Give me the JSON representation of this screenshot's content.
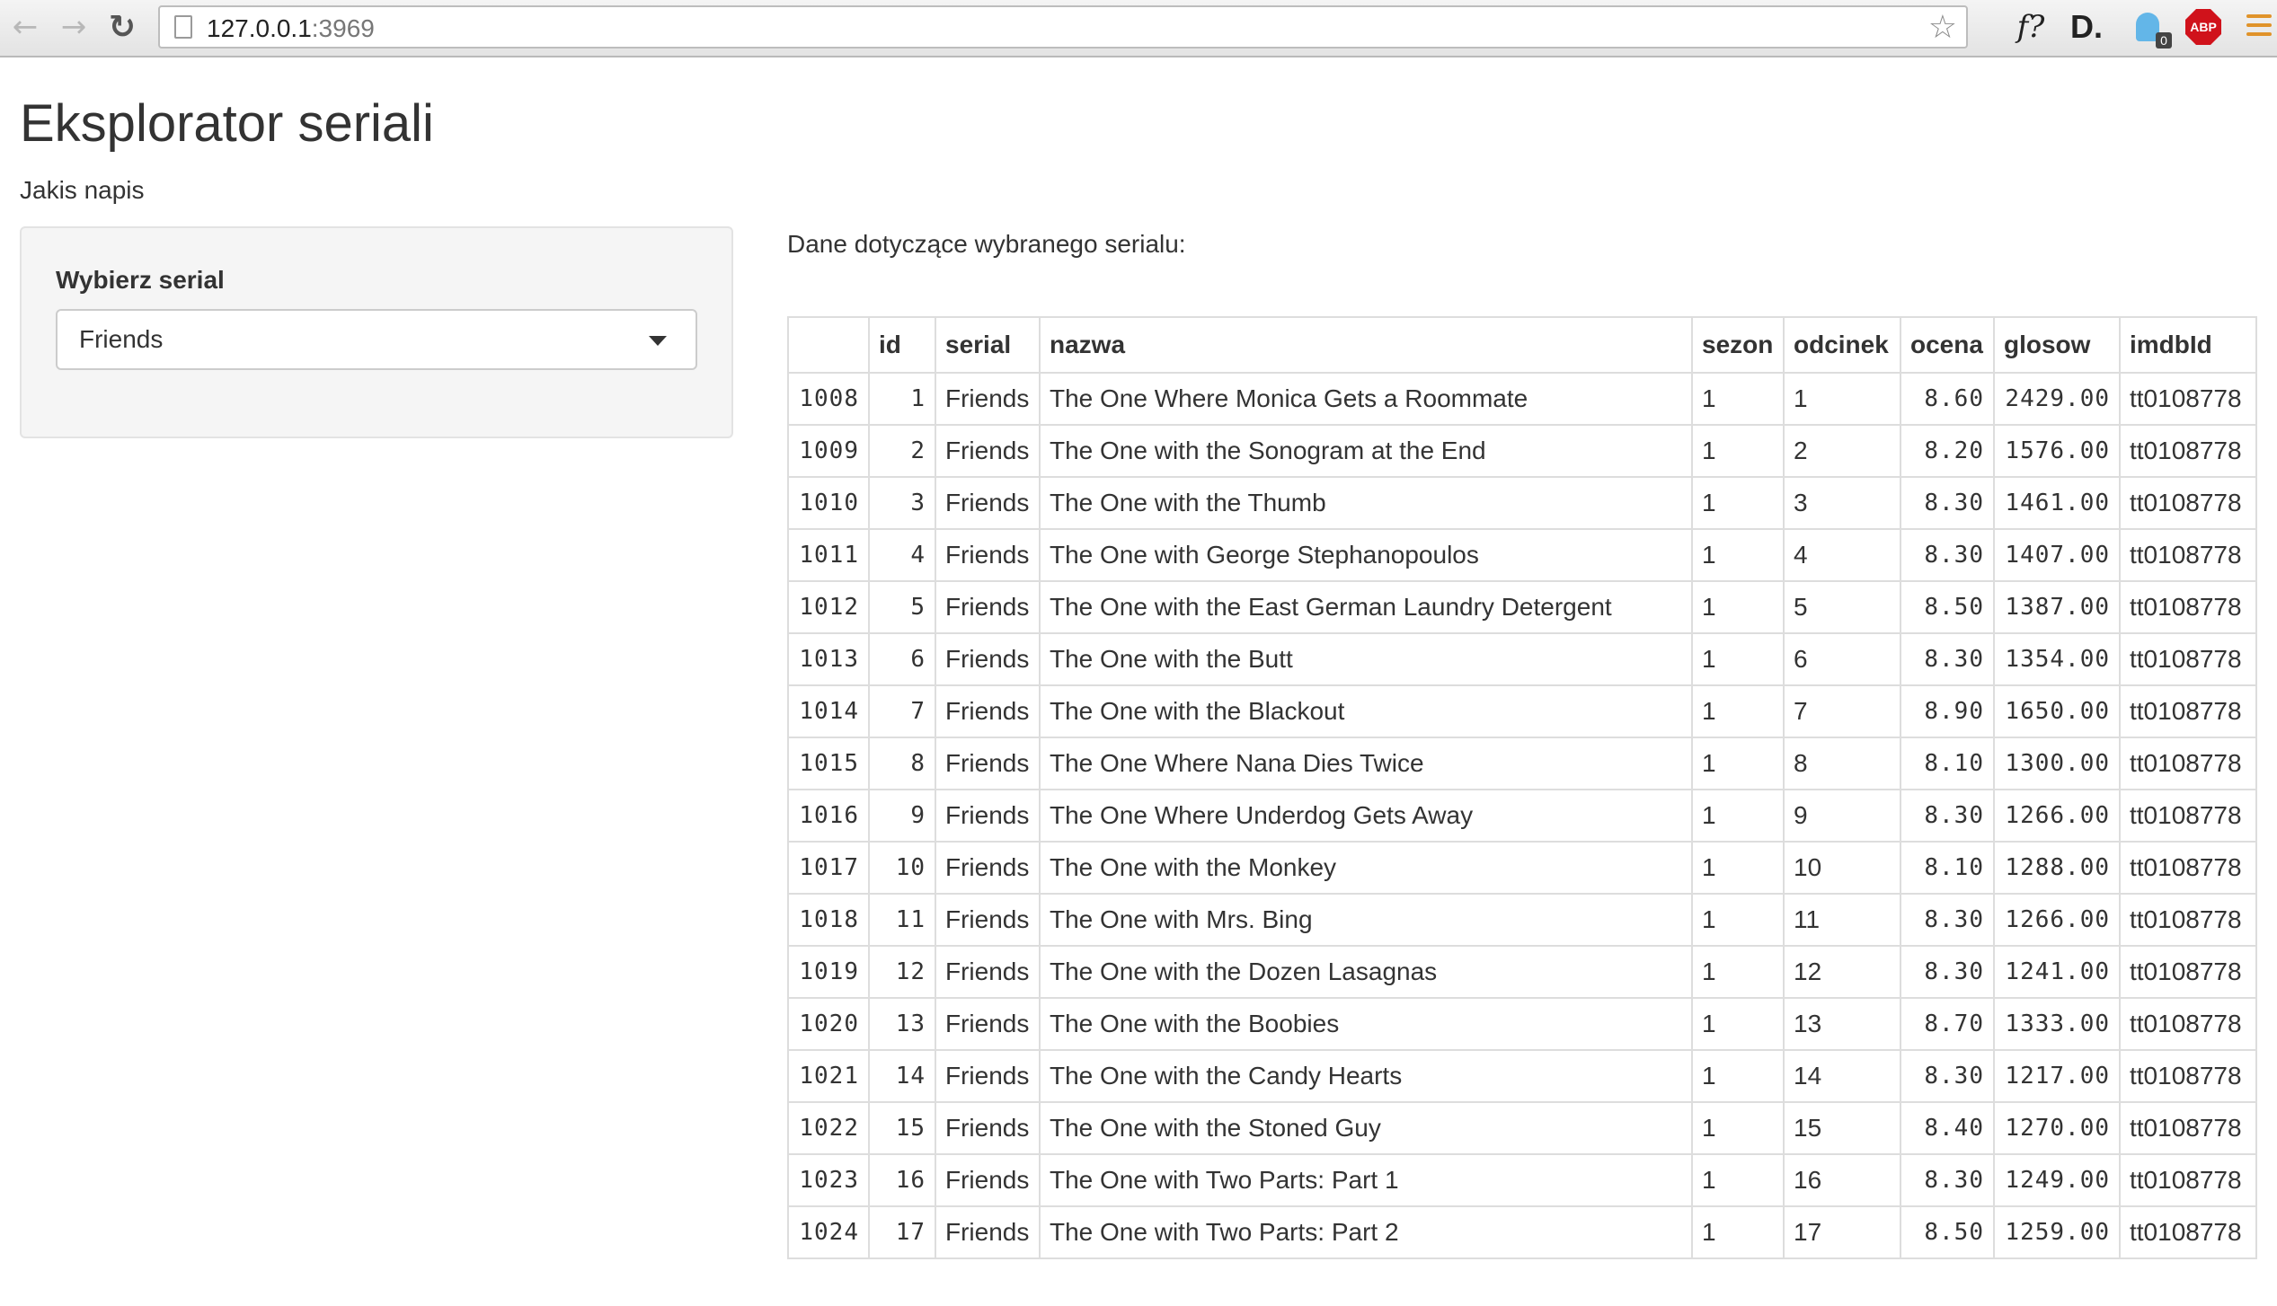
{
  "browser": {
    "url_host": "127.0.0.1",
    "url_port": ":3969",
    "extensions": {
      "f_label": "f?",
      "d_label": "D.",
      "ghost_badge": "0",
      "abp_label": "ABP"
    }
  },
  "page": {
    "title": "Eksplorator seriali",
    "subtitle": "Jakis napis"
  },
  "sidebar": {
    "select_label": "Wybierz serial",
    "select_value": "Friends"
  },
  "main": {
    "heading": "Dane dotyczące wybranego serialu:"
  },
  "table": {
    "columns": [
      "",
      "id",
      "serial",
      "nazwa",
      "sezon",
      "odcinek",
      "ocena",
      "glosow",
      "imdbId"
    ],
    "rows": [
      [
        "1008",
        "1",
        "Friends",
        "The One Where Monica Gets a Roommate",
        "1",
        "1",
        "8.60",
        "2429.00",
        "tt0108778"
      ],
      [
        "1009",
        "2",
        "Friends",
        "The One with the Sonogram at the End",
        "1",
        "2",
        "8.20",
        "1576.00",
        "tt0108778"
      ],
      [
        "1010",
        "3",
        "Friends",
        "The One with the Thumb",
        "1",
        "3",
        "8.30",
        "1461.00",
        "tt0108778"
      ],
      [
        "1011",
        "4",
        "Friends",
        "The One with George Stephanopoulos",
        "1",
        "4",
        "8.30",
        "1407.00",
        "tt0108778"
      ],
      [
        "1012",
        "5",
        "Friends",
        "The One with the East German Laundry Detergent",
        "1",
        "5",
        "8.50",
        "1387.00",
        "tt0108778"
      ],
      [
        "1013",
        "6",
        "Friends",
        "The One with the Butt",
        "1",
        "6",
        "8.30",
        "1354.00",
        "tt0108778"
      ],
      [
        "1014",
        "7",
        "Friends",
        "The One with the Blackout",
        "1",
        "7",
        "8.90",
        "1650.00",
        "tt0108778"
      ],
      [
        "1015",
        "8",
        "Friends",
        "The One Where Nana Dies Twice",
        "1",
        "8",
        "8.10",
        "1300.00",
        "tt0108778"
      ],
      [
        "1016",
        "9",
        "Friends",
        "The One Where Underdog Gets Away",
        "1",
        "9",
        "8.30",
        "1266.00",
        "tt0108778"
      ],
      [
        "1017",
        "10",
        "Friends",
        "The One with the Monkey",
        "1",
        "10",
        "8.10",
        "1288.00",
        "tt0108778"
      ],
      [
        "1018",
        "11",
        "Friends",
        "The One with Mrs. Bing",
        "1",
        "11",
        "8.30",
        "1266.00",
        "tt0108778"
      ],
      [
        "1019",
        "12",
        "Friends",
        "The One with the Dozen Lasagnas",
        "1",
        "12",
        "8.30",
        "1241.00",
        "tt0108778"
      ],
      [
        "1020",
        "13",
        "Friends",
        "The One with the Boobies",
        "1",
        "13",
        "8.70",
        "1333.00",
        "tt0108778"
      ],
      [
        "1021",
        "14",
        "Friends",
        "The One with the Candy Hearts",
        "1",
        "14",
        "8.30",
        "1217.00",
        "tt0108778"
      ],
      [
        "1022",
        "15",
        "Friends",
        "The One with the Stoned Guy",
        "1",
        "15",
        "8.40",
        "1270.00",
        "tt0108778"
      ],
      [
        "1023",
        "16",
        "Friends",
        "The One with Two Parts: Part 1",
        "1",
        "16",
        "8.30",
        "1249.00",
        "tt0108778"
      ],
      [
        "1024",
        "17",
        "Friends",
        "The One with Two Parts: Part 2",
        "1",
        "17",
        "8.50",
        "1259.00",
        "tt0108778"
      ]
    ]
  }
}
